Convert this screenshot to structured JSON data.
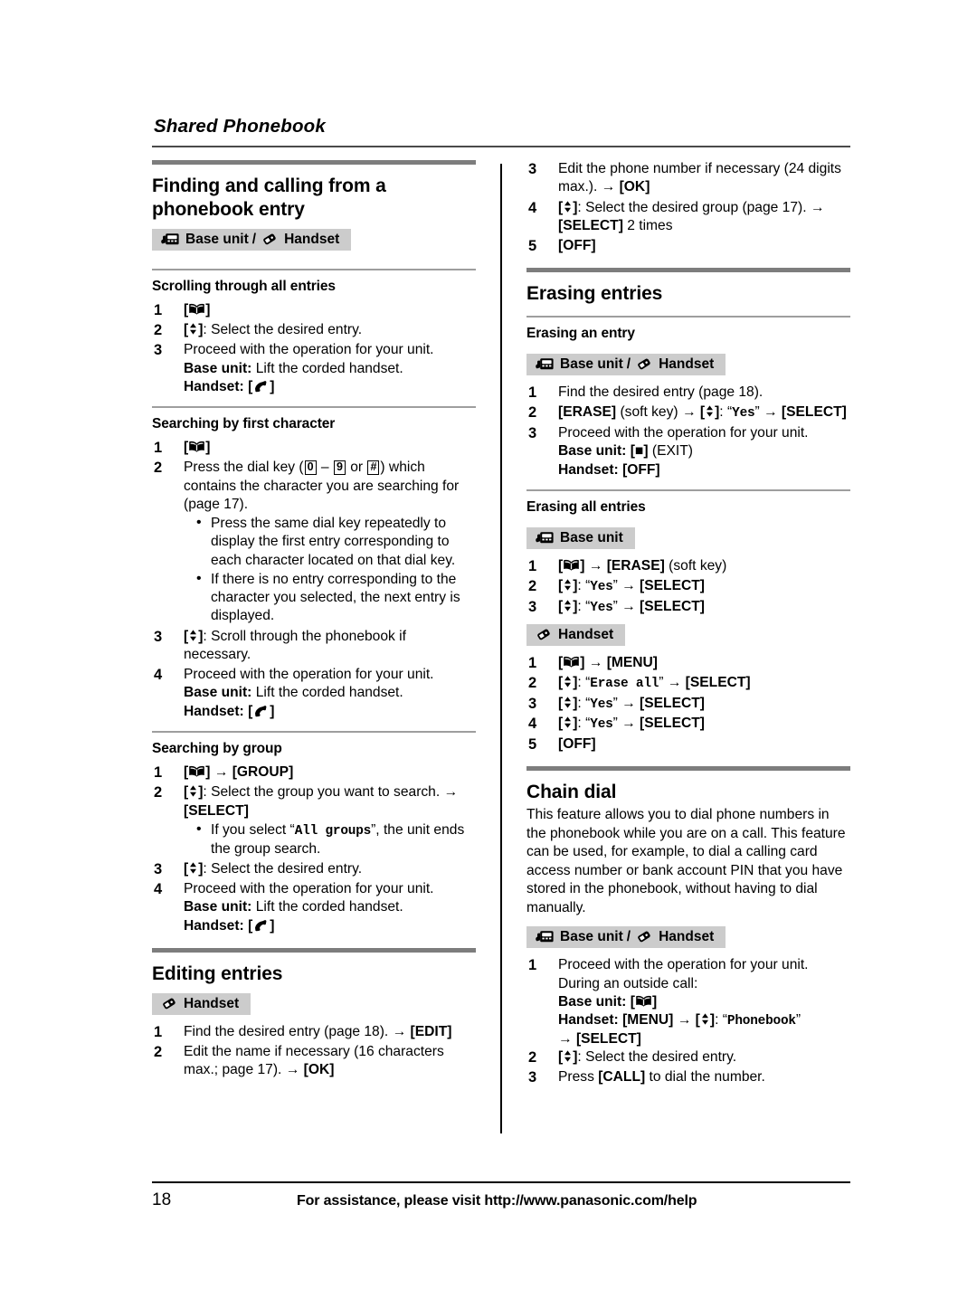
{
  "running_head": "Shared Phonebook",
  "footer": {
    "page_number": "18",
    "assistance_text": "For assistance, please visit http://www.panasonic.com/help"
  },
  "badges": {
    "base_unit_slash_handset": {
      "base_label": "Base unit",
      "separator": "/",
      "handset_label": "Handset"
    },
    "base_unit": {
      "label": "Base unit"
    },
    "handset": {
      "label": "Handset"
    }
  },
  "left_column": {
    "section_title": "Finding and calling from a phonebook entry",
    "subsections": [
      {
        "title": "Scrolling through all entries",
        "steps": [
          {
            "num": "1",
            "text": "[☆] phonebook key"
          },
          {
            "num": "2",
            "text": ": Select the desired entry."
          },
          {
            "num": "3",
            "text": "Proceed with the operation for your unit.",
            "base_unit_label": "Base unit:",
            "base_unit_text": "Lift the corded handset.",
            "handset_label": "Handset:"
          }
        ]
      },
      {
        "title": "Searching by first character",
        "steps": [
          {
            "num": "1",
            "text": "[phonebook]"
          },
          {
            "num": "2",
            "lead": "Press the dial key (",
            "key_low": "0",
            "dash": "–",
            "key_high": "9",
            "or": "or",
            "key_hash": "#",
            "tail": ") which contains the character you are searching for (page 17).",
            "bullets": [
              "Press the same dial key repeatedly to display the first entry corresponding to each character located on that dial key.",
              "If there is no entry corresponding to the character you selected, the next entry is displayed."
            ]
          },
          {
            "num": "3",
            "text": ": Scroll through the phonebook if necessary."
          },
          {
            "num": "4",
            "text": "Proceed with the operation for your unit.",
            "base_unit_label": "Base unit:",
            "base_unit_text": "Lift the corded handset.",
            "handset_label": "Handset:"
          }
        ]
      },
      {
        "title": "Searching by group",
        "steps": [
          {
            "num": "1",
            "key_group": "[GROUP]"
          },
          {
            "num": "2",
            "text": ": Select the group you want to search.",
            "key_select": "[SELECT]",
            "bullets_rich": [
              {
                "pre": "If you select “",
                "mono": "All groups",
                "post": "”, the unit ends the group search."
              }
            ]
          },
          {
            "num": "3",
            "text": ": Select the desired entry."
          },
          {
            "num": "4",
            "text": "Proceed with the operation for your unit.",
            "base_unit_label": "Base unit:",
            "base_unit_text": "Lift the corded handset.",
            "handset_label": "Handset:"
          }
        ]
      }
    ],
    "editing_entries": {
      "section_title": "Editing entries",
      "steps": [
        {
          "num": "1",
          "text": "Find the desired entry (page 18).",
          "key": "[EDIT]"
        },
        {
          "num": "2",
          "text": "Edit the name if necessary (16 characters max.; page 17).",
          "key": "[OK]"
        }
      ]
    }
  },
  "right_column": {
    "continued_steps": [
      {
        "num": "3",
        "text": "Edit the phone number if necessary (24 digits max.).",
        "key": "[OK]"
      },
      {
        "num": "4",
        "text": ": Select the desired group (page 17).",
        "key": "[SELECT]",
        "suffix": "2 times"
      },
      {
        "num": "5",
        "key": "[OFF]"
      }
    ],
    "erasing_entries": {
      "section_title": "Erasing entries",
      "erasing_an_entry": {
        "title": "Erasing an entry",
        "steps": [
          {
            "num": "1",
            "text": "Find the desired entry (page 18)."
          },
          {
            "num": "2",
            "key1": "[ERASE]",
            "soft_key": "(soft key)",
            "quoted": "Yes",
            "key2": "[SELECT]"
          },
          {
            "num": "3",
            "text": "Proceed with the operation for your unit.",
            "base_unit_label": "Base unit:",
            "base_unit_key": "[■]",
            "base_unit_note": "(EXIT)",
            "handset_label": "Handset:",
            "handset_key": "[OFF]"
          }
        ]
      },
      "erasing_all_entries": {
        "title": "Erasing all entries",
        "base_unit_steps": [
          {
            "num": "1",
            "key": "[ERASE]",
            "soft_key": "(soft key)"
          },
          {
            "num": "2",
            "quoted": "Yes",
            "key": "[SELECT]"
          },
          {
            "num": "3",
            "quoted": "Yes",
            "key": "[SELECT]"
          }
        ],
        "handset_steps": [
          {
            "num": "1",
            "key": "[MENU]"
          },
          {
            "num": "2",
            "quoted": "Erase all",
            "key": "[SELECT]"
          },
          {
            "num": "3",
            "quoted": "Yes",
            "key": "[SELECT]"
          },
          {
            "num": "4",
            "quoted": "Yes",
            "key": "[SELECT]"
          },
          {
            "num": "5",
            "key": "[OFF]"
          }
        ]
      }
    },
    "chain_dial": {
      "section_title": "Chain dial",
      "description": "This feature allows you to dial phone numbers in the phonebook while you are on a call. This feature can be used, for example, to dial a calling card access number or bank account PIN that you have stored in the phonebook, without having to dial manually.",
      "steps": [
        {
          "num": "1",
          "text": "Proceed with the operation for your unit.",
          "during_call": "During an outside call:",
          "base_unit_label": "Base unit:",
          "handset_label": "Handset:",
          "handset_key1": "[MENU]",
          "handset_quoted": "Phonebook",
          "handset_key2": "[SELECT]"
        },
        {
          "num": "2",
          "text": ": Select the desired entry."
        },
        {
          "num": "3",
          "pre": "Press",
          "key": "[CALL]",
          "post": "to dial the number."
        }
      ]
    }
  },
  "colors": {
    "rule_thick": "#7d7d7d",
    "rule_thin": "#9e9e9e",
    "badge_bg": "#cccccc",
    "text": "#000000"
  }
}
